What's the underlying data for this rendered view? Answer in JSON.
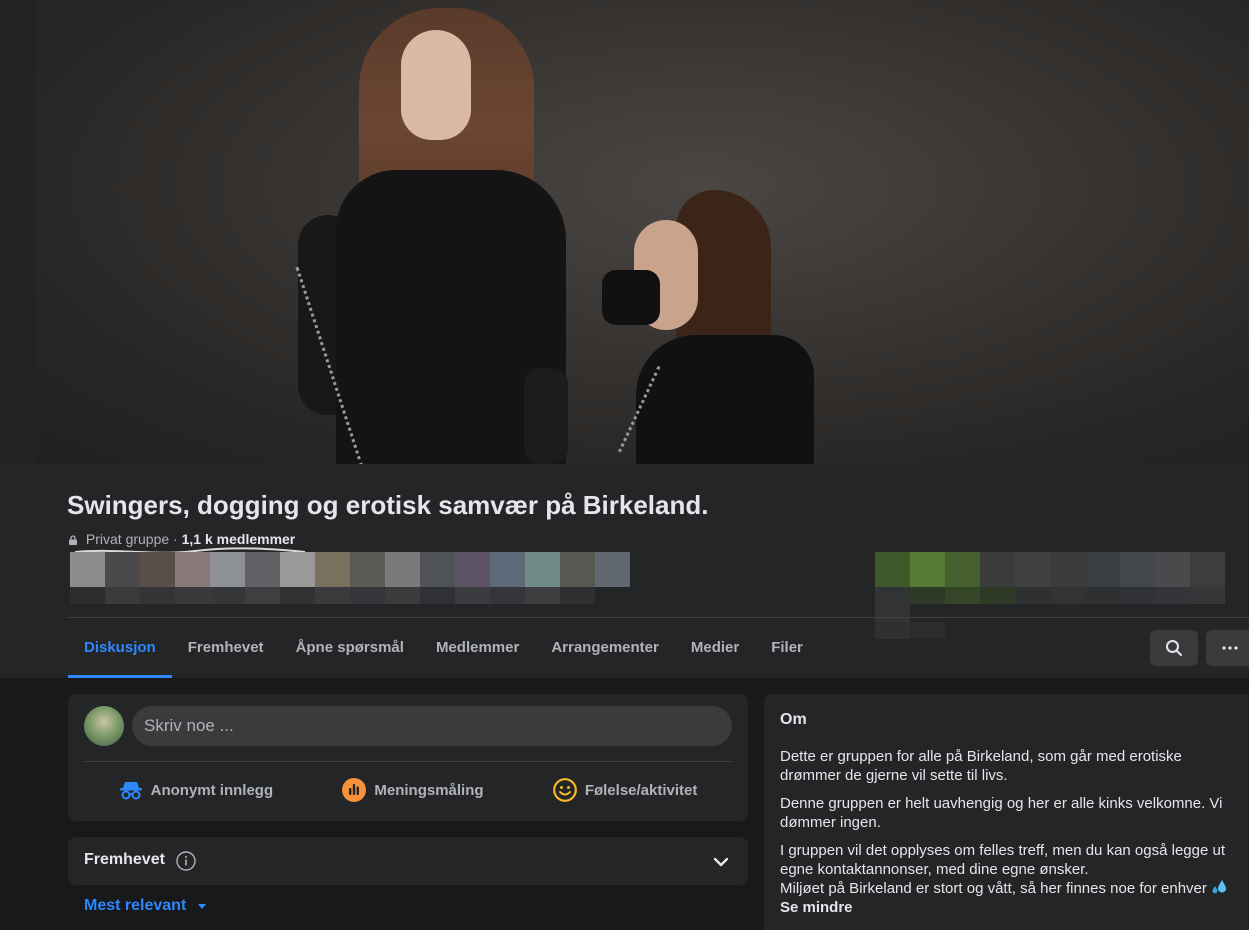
{
  "group": {
    "title": "Swingers, dogging og erotisk samvær på Birkeland.",
    "privacy": "Privat gruppe",
    "separator": " · ",
    "members": "1,1 k medlemmer"
  },
  "tabs": [
    {
      "label": "Diskusjon",
      "active": true
    },
    {
      "label": "Fremhevet",
      "active": false
    },
    {
      "label": "Åpne spørsmål",
      "active": false
    },
    {
      "label": "Medlemmer",
      "active": false
    },
    {
      "label": "Arrangementer",
      "active": false
    },
    {
      "label": "Medier",
      "active": false
    },
    {
      "label": "Filer",
      "active": false
    }
  ],
  "toolbar_icons": [
    "search-icon",
    "more-options-icon"
  ],
  "composer": {
    "placeholder": "Skriv noe ...",
    "actions": [
      {
        "label": "Anonymt innlegg",
        "icon": "incognito-icon",
        "color": "#2d88ff"
      },
      {
        "label": "Meningsmåling",
        "icon": "poll-icon",
        "color": "#f7923b"
      },
      {
        "label": "Følelse/aktivitet",
        "icon": "smiley-icon",
        "color": "#f7b928"
      }
    ]
  },
  "featured": {
    "title": "Fremhevet"
  },
  "sort": {
    "label": "Mest relevant"
  },
  "about": {
    "title": "Om",
    "paragraph1": "Dette er gruppen for alle på Birkeland, som går med erotiske drømmer de gjerne vil sette til livs.",
    "paragraph2": "Denne gruppen er helt uavhengig og her er alle kinks velkomne. Vi dømmer ingen.",
    "paragraph3": "I gruppen vil det opplyses om felles treff, men du kan også legge ut egne kontaktannonser, med dine egne ønsker.",
    "paragraph4": "Miljøet på Birkeland er stort og vått, så her finnes noe for enhver",
    "see_less": "Se mindre"
  },
  "colors": {
    "accent": "#2d88ff",
    "surface": "#242526",
    "background": "#18191a"
  }
}
